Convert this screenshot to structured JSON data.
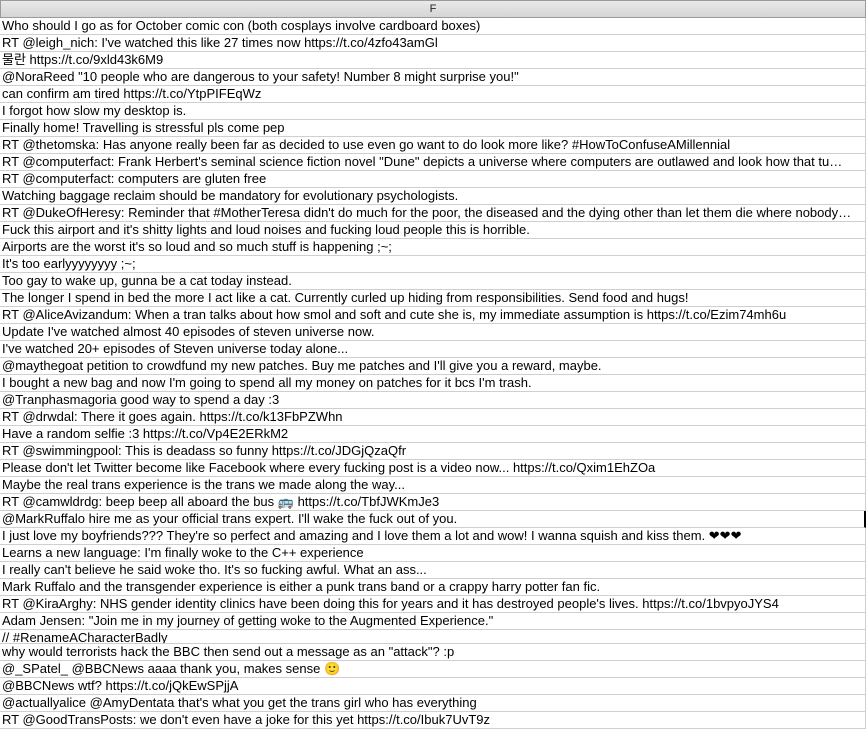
{
  "sheet": {
    "column_header": "F",
    "rows": [
      "Who should I go as for October comic con (both cosplays involve cardboard boxes)",
      "RT @leigh_nich: I've watched this like 27 times now https://t.co/4zfo43amGl",
      "물란 https://t.co/9xld43k6M9",
      "@NoraReed \"10 people who are dangerous to your safety! Number 8 might surprise you!\"",
      "can confirm am tired https://t.co/YtpPIFEqWz",
      "I forgot how slow my desktop is.",
      "Finally home! Travelling is stressful pls come pep",
      "RT @thetomska: Has anyone really been far as decided to use even go want to do look more like? #HowToConfuseAMillennial",
      "RT @computerfact: Frank Herbert's seminal science fiction novel \"Dune\" depicts a universe where computers are outlawed and look how that tu…",
      "RT @computerfact: computers are gluten free",
      "Watching baggage reclaim should be mandatory for evolutionary psychologists.",
      "RT @DukeOfHeresy: Reminder that #MotherTeresa didn't do much for the poor, the diseased and the dying other than let them die where nobody…",
      "Fuck this airport and it's shitty lights and loud noises and fucking loud people this is horrible.",
      "Airports are the worst it's so loud and so much stuff is happening ;~;",
      "It's too earlyyyyyyyy ;~;",
      "Too gay to wake up, gunna be a cat today instead.",
      "The longer I spend in bed the more I act like a cat. Currently curled up hiding from responsibilities. Send food and hugs!",
      "RT @AliceAvizandum: When a tran talks about how smol and soft and cute she is, my immediate assumption is https://t.co/Ezim74mh6u",
      "Update I've watched almost 40 episodes of steven universe now.",
      "I've watched 20+ episodes of Steven universe today alone...",
      "@maythegoat petition to crowdfund my new patches. Buy me patches and I'll give you a reward, maybe.",
      "I bought a new bag and now I'm going to spend all my money on patches for it bcs I'm trash.",
      "@Tranphasmagoria good way to spend a day :3",
      "RT @drwdal: There it goes again. https://t.co/k13FbPZWhn",
      "Have a random selfie :3 https://t.co/Vp4E2ERkM2",
      "RT @swimmingpool: This is deadass so funny https://t.co/JDGjQzaQfr",
      "Please don't let Twitter become like Facebook where every fucking post is a video now... https://t.co/Qxim1EhZOa",
      "Maybe the real trans experience is the trans we made along the way...",
      "RT @camwldrdg: beep beep all aboard the bus 🚌 https://t.co/TbfJWKmJe3",
      "@MarkRuffalo hire me as your official trans expert. I'll wake the fuck out of you.",
      "I just love my boyfriends??? They're so perfect and amazing and I love them a lot and wow! I wanna squish and kiss them. ❤❤❤",
      "Learns a new language: I'm finally woke to the C++ experience",
      "I really can't believe he said woke tho. It's so fucking awful. What an ass...",
      "Mark Ruffalo and the transgender experience is either a punk trans band or a crappy harry potter fan fic.",
      "RT @KiraArghy: NHS gender identity clinics have been doing this for years and it has destroyed people's lives. https://t.co/1bvpyoJYS4",
      "Adam Jensen: \"Join me in my journey of getting woke to the Augmented Experience.\"",
      "// #RenameACharacterBadly",
      "why would terrorists hack the BBC then send out a message as an \"attack\"? :p",
      "@_SPatel_ @BBCNews aaaa thank you, makes sense 🙂",
      "@BBCNews wtf? https://t.co/jQkEwSPjjA",
      "@actuallyalice @AmyDentata that's what you get the trans girl who has everything",
      "RT @GoodTransPosts: we don't even have a joke for this yet https://t.co/Ibuk7UvT9z"
    ]
  }
}
